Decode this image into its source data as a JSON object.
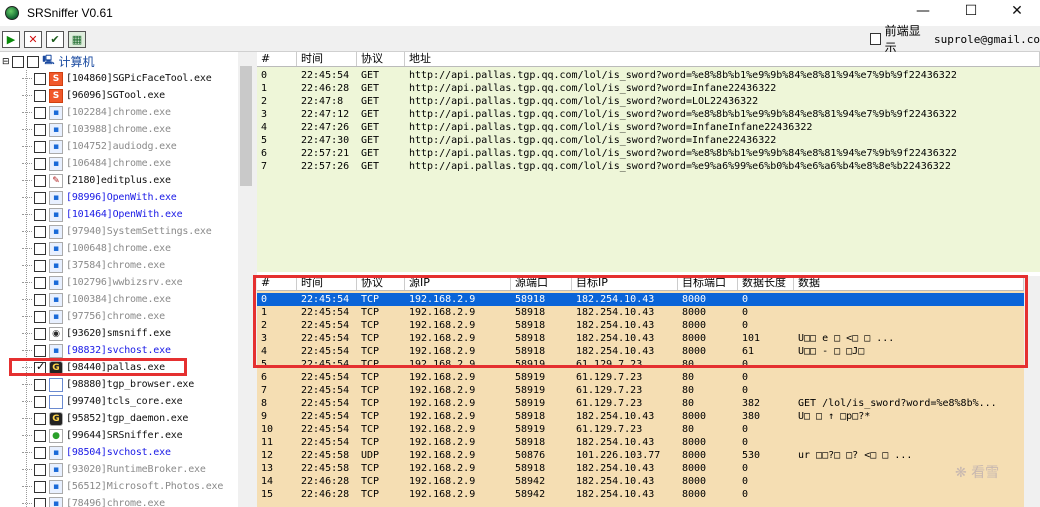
{
  "window": {
    "title": "SRSniffer V0.61",
    "minimize": "—",
    "maximize": "☐",
    "close": "✕"
  },
  "toolbar": {
    "start_glyph": "▶",
    "stop_glyph": "✕",
    "check_glyph": "✔",
    "export_glyph": "▦",
    "front_display_label": "前端显示",
    "user_email": "suprole@gmail.co"
  },
  "tree": {
    "root_label": "计算机",
    "processes": [
      {
        "label": "[104860]SGPicFaceTool.exe",
        "color": "black",
        "icon": "sogou-s-icon",
        "checked": false
      },
      {
        "label": "[96096]SGTool.exe",
        "color": "black",
        "icon": "sogou-s-icon",
        "checked": false
      },
      {
        "label": "[102284]chrome.exe",
        "color": "gray",
        "icon": "window-app-icon",
        "checked": false
      },
      {
        "label": "[103988]chrome.exe",
        "color": "gray",
        "icon": "window-app-icon",
        "checked": false
      },
      {
        "label": "[104752]audiodg.exe",
        "color": "gray",
        "icon": "window-app-icon",
        "checked": false
      },
      {
        "label": "[106484]chrome.exe",
        "color": "gray",
        "icon": "window-app-icon",
        "checked": false
      },
      {
        "label": "[2180]editplus.exe",
        "color": "black",
        "icon": "editplus-icon",
        "checked": false
      },
      {
        "label": "[98996]OpenWith.exe",
        "color": "blue",
        "icon": "window-app-icon",
        "checked": false
      },
      {
        "label": "[101464]OpenWith.exe",
        "color": "blue",
        "icon": "window-app-icon",
        "checked": false
      },
      {
        "label": "[97940]SystemSettings.exe",
        "color": "gray",
        "icon": "window-app-icon",
        "checked": false
      },
      {
        "label": "[100648]chrome.exe",
        "color": "gray",
        "icon": "window-app-icon",
        "checked": false
      },
      {
        "label": "[37584]chrome.exe",
        "color": "gray",
        "icon": "window-app-icon",
        "checked": false
      },
      {
        "label": "[102796]wwbizsrv.exe",
        "color": "gray",
        "icon": "window-app-icon",
        "checked": false
      },
      {
        "label": "[100384]chrome.exe",
        "color": "gray",
        "icon": "window-app-icon",
        "checked": false
      },
      {
        "label": "[97756]chrome.exe",
        "color": "gray",
        "icon": "window-app-icon",
        "checked": false
      },
      {
        "label": "[93620]smsniff.exe",
        "color": "black",
        "icon": "smsniff-icon",
        "checked": false
      },
      {
        "label": "[98832]svchost.exe",
        "color": "blue",
        "icon": "window-app-icon",
        "checked": false
      },
      {
        "label": "[98440]pallas.exe",
        "color": "black",
        "icon": "pallas-icon",
        "checked": true
      },
      {
        "label": "[98880]tgp_browser.exe",
        "color": "black",
        "icon": "blank-window-icon",
        "checked": false
      },
      {
        "label": "[99740]tcls_core.exe",
        "color": "black",
        "icon": "blank-window-icon",
        "checked": false
      },
      {
        "label": "[95852]tgp_daemon.exe",
        "color": "black",
        "icon": "pallas-icon",
        "checked": false
      },
      {
        "label": "[99644]SRSniffer.exe",
        "color": "black",
        "icon": "srsniffer-icon",
        "checked": false
      },
      {
        "label": "[98504]svchost.exe",
        "color": "blue",
        "icon": "window-app-icon",
        "checked": false
      },
      {
        "label": "[93020]RuntimeBroker.exe",
        "color": "gray",
        "icon": "window-app-icon",
        "checked": false
      },
      {
        "label": "[56512]Microsoft.Photos.exe",
        "color": "gray",
        "icon": "window-app-icon",
        "checked": false
      },
      {
        "label": "[78496]chrome.exe",
        "color": "gray",
        "icon": "window-app-icon",
        "checked": false
      }
    ]
  },
  "url_table": {
    "columns": [
      "#",
      "时间",
      "协议",
      "地址"
    ],
    "rows": [
      [
        "0",
        "22:45:54",
        "GET",
        "http://api.pallas.tgp.qq.com/lol/is_sword?word=%e8%8b%b1%e9%9b%84%e8%81%94%e7%9b%9f22436322"
      ],
      [
        "1",
        "22:46:28",
        "GET",
        "http://api.pallas.tgp.qq.com/lol/is_sword?word=Infane22436322"
      ],
      [
        "2",
        "22:47:8",
        "GET",
        "http://api.pallas.tgp.qq.com/lol/is_sword?word=LOL22436322"
      ],
      [
        "3",
        "22:47:12",
        "GET",
        "http://api.pallas.tgp.qq.com/lol/is_sword?word=%e8%8b%b1%e9%9b%84%e8%81%94%e7%9b%9f22436322"
      ],
      [
        "4",
        "22:47:26",
        "GET",
        "http://api.pallas.tgp.qq.com/lol/is_sword?word=InfaneInfane22436322"
      ],
      [
        "5",
        "22:47:30",
        "GET",
        "http://api.pallas.tgp.qq.com/lol/is_sword?word=Infane22436322"
      ],
      [
        "6",
        "22:57:21",
        "GET",
        "http://api.pallas.tgp.qq.com/lol/is_sword?word=%e8%8b%b1%e9%9b%84%e8%81%94%e7%9b%9f22436322"
      ],
      [
        "7",
        "22:57:26",
        "GET",
        "http://api.pallas.tgp.qq.com/lol/is_sword?word=%e9%a6%99%e6%b0%b4%e6%a6%b4%e8%8e%b22436322"
      ]
    ]
  },
  "packet_table": {
    "columns": [
      "#",
      "时间",
      "协议",
      "源IP",
      "源端口",
      "目标IP",
      "目标端口",
      "数据长度",
      "数据"
    ],
    "selected_index": 0,
    "rows": [
      [
        "0",
        "22:45:54",
        "TCP",
        "192.168.2.9",
        "58918",
        "182.254.10.43",
        "8000",
        "0",
        ""
      ],
      [
        "1",
        "22:45:54",
        "TCP",
        "192.168.2.9",
        "58918",
        "182.254.10.43",
        "8000",
        "0",
        ""
      ],
      [
        "2",
        "22:45:54",
        "TCP",
        "192.168.2.9",
        "58918",
        "182.254.10.43",
        "8000",
        "0",
        ""
      ],
      [
        "3",
        "22:45:54",
        "TCP",
        "192.168.2.9",
        "58918",
        "182.254.10.43",
        "8000",
        "101",
        "U□□    e        □ <□  □  ..."
      ],
      [
        "4",
        "22:45:54",
        "TCP",
        "192.168.2.9",
        "58918",
        "182.254.10.43",
        "8000",
        "61",
        "U□□   -    □ □J□"
      ],
      [
        "5",
        "22:45:54",
        "TCP",
        "192.168.2.9",
        "58919",
        "61.129.7.23",
        "80",
        "0",
        ""
      ],
      [
        "6",
        "22:45:54",
        "TCP",
        "192.168.2.9",
        "58919",
        "61.129.7.23",
        "80",
        "0",
        ""
      ],
      [
        "7",
        "22:45:54",
        "TCP",
        "192.168.2.9",
        "58919",
        "61.129.7.23",
        "80",
        "0",
        ""
      ],
      [
        "8",
        "22:45:54",
        "TCP",
        "192.168.2.9",
        "58919",
        "61.129.7.23",
        "80",
        "382",
        "GET /lol/is_sword?word=%e8%8b%..."
      ],
      [
        "9",
        "22:45:54",
        "TCP",
        "192.168.2.9",
        "58918",
        "182.254.10.43",
        "8000",
        "380",
        "U□ □    ↑  □p□?*"
      ],
      [
        "10",
        "22:45:54",
        "TCP",
        "192.168.2.9",
        "58919",
        "61.129.7.23",
        "80",
        "0",
        ""
      ],
      [
        "11",
        "22:45:54",
        "TCP",
        "192.168.2.9",
        "58918",
        "182.254.10.43",
        "8000",
        "0",
        ""
      ],
      [
        "12",
        "22:45:58",
        "UDP",
        "192.168.2.9",
        "50876",
        "101.226.103.77",
        "8000",
        "530",
        "ur □□?□      □? <□  □  ..."
      ],
      [
        "13",
        "22:45:58",
        "TCP",
        "192.168.2.9",
        "58918",
        "182.254.10.43",
        "8000",
        "0",
        ""
      ],
      [
        "14",
        "22:46:28",
        "TCP",
        "192.168.2.9",
        "58942",
        "182.254.10.43",
        "8000",
        "0",
        ""
      ],
      [
        "15",
        "22:46:28",
        "TCP",
        "192.168.2.9",
        "58942",
        "182.254.10.43",
        "8000",
        "0",
        ""
      ]
    ]
  },
  "colors": {
    "url_bg": "#eef6d8",
    "packet_bg": "#f5deb3",
    "selection": "#0a64d8",
    "highlight_box": "#e53030"
  }
}
